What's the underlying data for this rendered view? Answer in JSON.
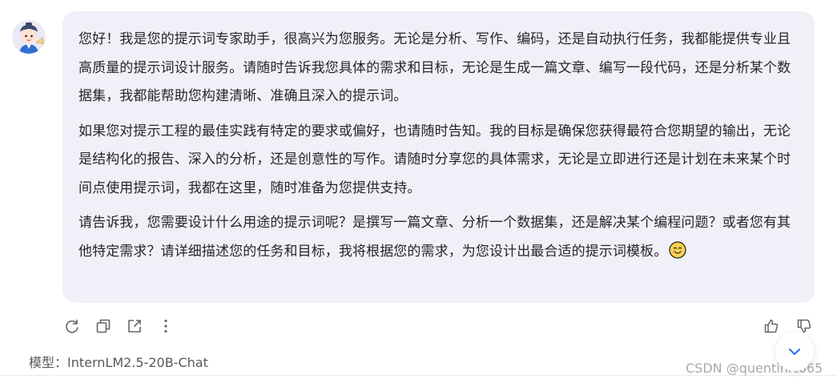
{
  "message": {
    "paragraphs": [
      "您好！我是您的提示词专家助手，很高兴为您服务。无论是分析、写作、编码，还是自动执行任务，我都能提供专业且高质量的提示词设计服务。请随时告诉我您具体的需求和目标，无论是生成一篇文章、编写一段代码，还是分析某个数据集，我都能帮助您构建清晰、准确且深入的提示词。",
      "如果您对提示工程的最佳实践有特定的要求或偏好，也请随时告知。我的目标是确保您获得最符合您期望的输出，无论是结构化的报告、深入的分析，还是创意性的写作。请随时分享您的具体需求，无论是立即进行还是计划在未来某个时间点使用提示词，我都在这里，随时准备为您提供支持。",
      "请告诉我，您需要设计什么用途的提示词呢？是撰写一篇文章、分析一个数据集，还是解决某个编程问题？或者您有其他特定需求？请详细描述您的任务和目标，我将根据您的需求，为您设计出最合适的提示词模板。"
    ],
    "emoji_icon": "smiling-face-emoji"
  },
  "actions": {
    "left": [
      "refresh-icon",
      "copy-icon",
      "share-icon",
      "more-vertical-icon"
    ],
    "right": [
      "thumbs-up-icon",
      "thumbs-down-icon"
    ]
  },
  "model": {
    "label": "模型：",
    "name": "InternLM2.5-20B-Chat"
  },
  "watermark": "CSDN @quentinrt665",
  "colors": {
    "bubble_bg": "#f0f1f8",
    "text": "#262626",
    "icon": "#666666"
  }
}
